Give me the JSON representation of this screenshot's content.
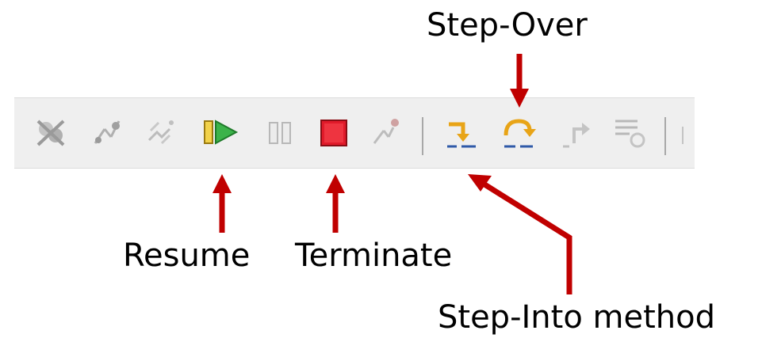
{
  "annotations": {
    "step_over": "Step-Over",
    "resume": "Resume",
    "terminate": "Terminate",
    "step_into": "Step-Into method"
  },
  "toolbar": {
    "buttons": [
      {
        "icon": "skip-all-breakpoints-icon",
        "enabled": false
      },
      {
        "icon": "drop-to-frame-icon",
        "enabled": false
      },
      {
        "icon": "connect-disconnect-icon",
        "enabled": false
      },
      {
        "icon": "resume-icon",
        "enabled": true,
        "color": "#2aa83a"
      },
      {
        "icon": "suspend-icon",
        "enabled": false
      },
      {
        "icon": "terminate-icon",
        "enabled": true,
        "color": "#e01a2a"
      },
      {
        "icon": "disconnect-icon",
        "enabled": false
      },
      {
        "icon": "step-into-icon",
        "enabled": true,
        "color": "#e8a417"
      },
      {
        "icon": "step-over-icon",
        "enabled": true,
        "color": "#e8a417"
      },
      {
        "icon": "step-return-icon",
        "enabled": false
      },
      {
        "icon": "use-step-filters-icon",
        "enabled": false
      }
    ]
  },
  "colors": {
    "arrow": "#c00000",
    "toolbar_bg": "#efefef",
    "disabled_icon": "#b8b8b8",
    "step_icon_underline": "#2f5aa8"
  }
}
